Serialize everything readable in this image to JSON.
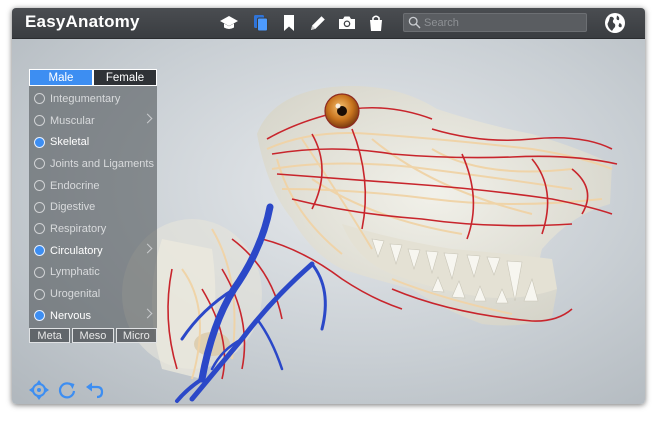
{
  "app": {
    "title": "EasyAnatomy"
  },
  "search": {
    "placeholder": "Search"
  },
  "sex_tabs": {
    "male": "Male",
    "female": "Female",
    "selected": "Male"
  },
  "systems": [
    {
      "label": "Integumentary",
      "checked": false,
      "has_submenu": false
    },
    {
      "label": "Muscular",
      "checked": false,
      "has_submenu": true
    },
    {
      "label": "Skeletal",
      "checked": true,
      "has_submenu": false
    },
    {
      "label": "Joints and Ligaments",
      "checked": false,
      "has_submenu": false
    },
    {
      "label": "Endocrine",
      "checked": false,
      "has_submenu": false
    },
    {
      "label": "Digestive",
      "checked": false,
      "has_submenu": false
    },
    {
      "label": "Respiratory",
      "checked": false,
      "has_submenu": false
    },
    {
      "label": "Circulatory",
      "checked": true,
      "has_submenu": true
    },
    {
      "label": "Lymphatic",
      "checked": false,
      "has_submenu": false
    },
    {
      "label": "Urogenital",
      "checked": false,
      "has_submenu": false
    },
    {
      "label": "Nervous",
      "checked": true,
      "has_submenu": true
    }
  ],
  "scale_tabs": [
    "Meta",
    "Meso",
    "Micro"
  ],
  "icons": {
    "toolbar": [
      "graduation-cap-icon",
      "layers-icon",
      "bookmark-icon",
      "pencil-icon",
      "camera-icon",
      "shopping-bag-icon"
    ],
    "globe": "globe-icon",
    "bottom": [
      "move-icon",
      "reset-rotation-icon",
      "undo-icon"
    ]
  },
  "colors": {
    "accent": "#3d8ef2",
    "toolbar": "#3f4246",
    "artery": "#c8252c",
    "vein": "#2b48c8",
    "nerve": "#f0d3a6",
    "bone": "#ecebe2"
  }
}
